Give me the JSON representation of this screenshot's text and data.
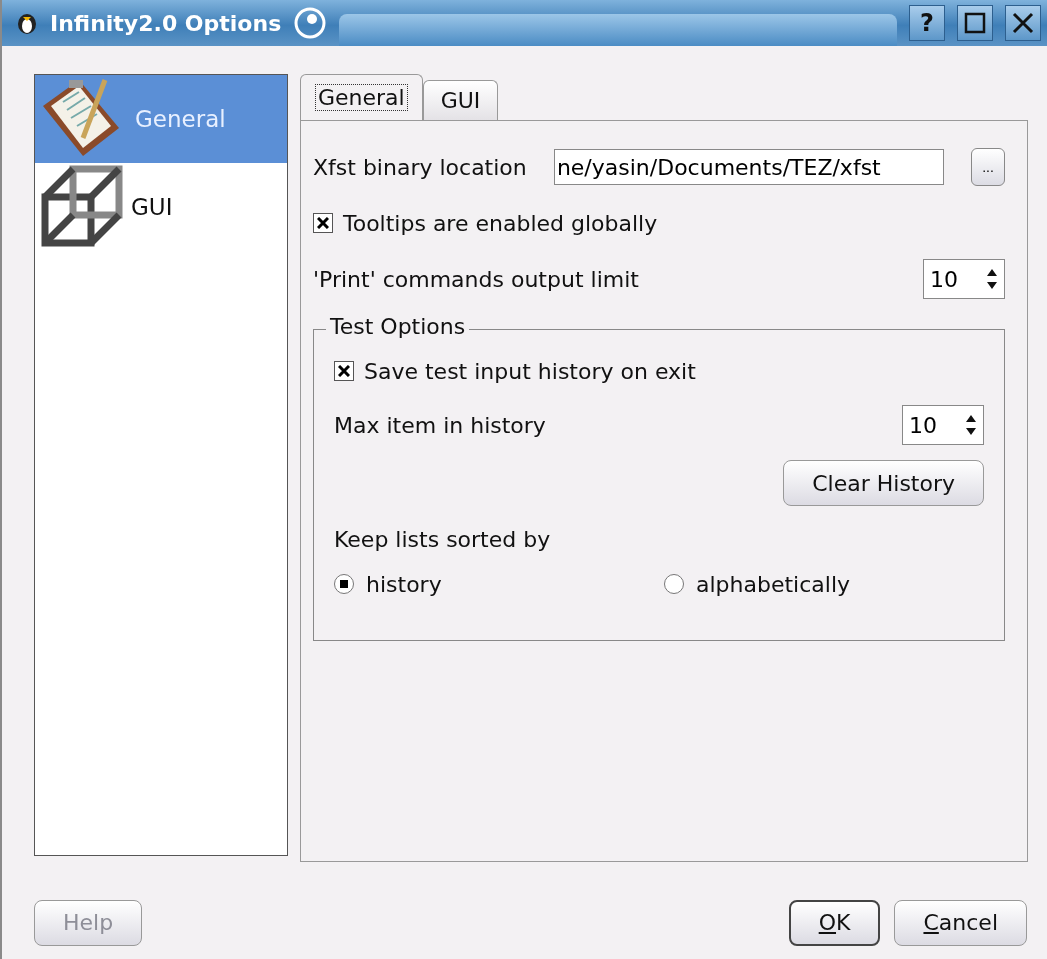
{
  "window": {
    "title": "Infinity2.0 Options",
    "help_label": "?"
  },
  "sidebar": {
    "items": [
      {
        "label": "General",
        "selected": true
      },
      {
        "label": "GUI",
        "selected": false
      }
    ]
  },
  "tabs": [
    {
      "label": "General",
      "selected": true
    },
    {
      "label": "GUI",
      "selected": false
    }
  ],
  "general": {
    "binary_location": {
      "label": "Xfst binary location",
      "value": "ne/yasin/Documents/TEZ/xfst",
      "browse_label": "..."
    },
    "tooltips": {
      "label": "Tooltips are enabled globally",
      "checked": true
    },
    "print_limit": {
      "label": "'Print' commands output limit",
      "value": "10"
    },
    "test_options": {
      "title": "Test Options",
      "save_history": {
        "label": "Save test input history on exit",
        "checked": true
      },
      "max_items": {
        "label": "Max item in history",
        "value": "10"
      },
      "clear_button": "Clear History",
      "sort_label": "Keep lists sorted by",
      "sort_options": [
        {
          "label": "history",
          "selected": true
        },
        {
          "label": "alphabetically",
          "selected": false
        }
      ]
    }
  },
  "buttons": [
    {
      "label": "Help",
      "disabled": true,
      "default": false,
      "mnemonic": false
    },
    {
      "label": "OK",
      "disabled": false,
      "default": true,
      "mnemonic": true
    },
    {
      "label": "Cancel",
      "disabled": false,
      "default": false,
      "mnemonic": true
    }
  ]
}
